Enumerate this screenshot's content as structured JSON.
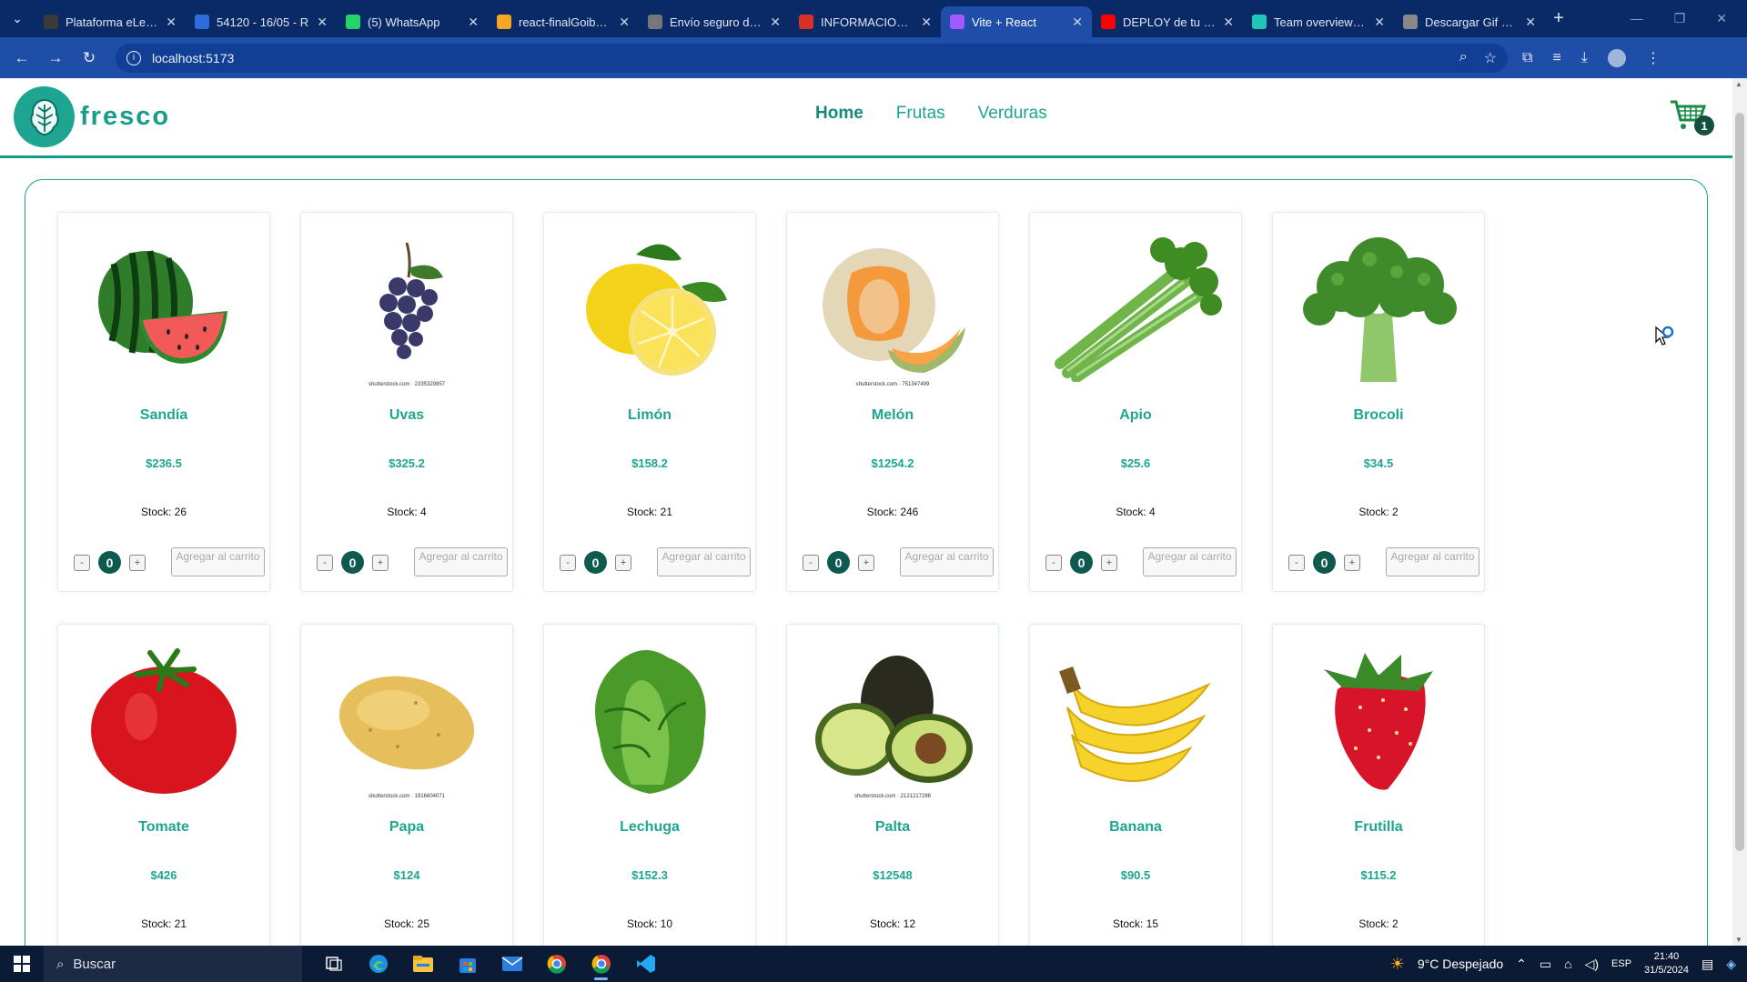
{
  "browser": {
    "tabs": [
      {
        "title": "Plataforma eLearn",
        "icon": "elearning-icon",
        "color": "#3a3a3a",
        "active": false
      },
      {
        "title": "54120 - 16/05 - R",
        "icon": "zoom-icon",
        "color": "#2d6cdf",
        "active": false
      },
      {
        "title": "(5) WhatsApp",
        "icon": "whatsapp-icon",
        "color": "#25d366",
        "active": false
      },
      {
        "title": "react-finalGoiburu",
        "icon": "firebase-icon",
        "color": "#f5a623",
        "active": false
      },
      {
        "title": "Envío seguro de c",
        "icon": "shield-icon",
        "color": "#777777",
        "active": false
      },
      {
        "title": "INFORMACION M",
        "icon": "gmail-icon",
        "color": "#d93025",
        "active": false
      },
      {
        "title": "Vite + React",
        "icon": "vite-icon",
        "color": "#a259ff",
        "active": true
      },
      {
        "title": "DEPLOY de tu app",
        "icon": "youtube-icon",
        "color": "#ff0000",
        "active": false
      },
      {
        "title": "Team overview | s",
        "icon": "netlify-icon",
        "color": "#20c6b7",
        "active": false
      },
      {
        "title": "Descargar Gif Rec",
        "icon": "gif-icon",
        "color": "#888888",
        "active": false
      }
    ],
    "url": "localhost:5173"
  },
  "header": {
    "logo_text": "fresco",
    "nav": [
      {
        "label": "Home",
        "active": true
      },
      {
        "label": "Frutas",
        "active": false
      },
      {
        "label": "Verduras",
        "active": false
      }
    ],
    "cart_count": "1"
  },
  "products": [
    {
      "name": "Sandía",
      "price": "$236.5",
      "stock": "Stock: 26",
      "qty": "0",
      "icon": "watermelon-image",
      "credit": ""
    },
    {
      "name": "Uvas",
      "price": "$325.2",
      "stock": "Stock: 4",
      "qty": "0",
      "icon": "grapes-image",
      "credit": "shutterstock.com · 2335329857"
    },
    {
      "name": "Limón",
      "price": "$158.2",
      "stock": "Stock: 21",
      "qty": "0",
      "icon": "lemon-image",
      "credit": ""
    },
    {
      "name": "Melón",
      "price": "$1254.2",
      "stock": "Stock: 246",
      "qty": "0",
      "icon": "melon-image",
      "credit": "shutterstock.com · 751347499"
    },
    {
      "name": "Apio",
      "price": "$25.6",
      "stock": "Stock: 4",
      "qty": "0",
      "icon": "celery-image",
      "credit": ""
    },
    {
      "name": "Brocoli",
      "price": "$34.5",
      "stock": "Stock: 2",
      "qty": "0",
      "icon": "broccoli-image",
      "credit": ""
    },
    {
      "name": "Tomate",
      "price": "$426",
      "stock": "Stock: 21",
      "qty": "0",
      "icon": "tomato-image",
      "credit": ""
    },
    {
      "name": "Papa",
      "price": "$124",
      "stock": "Stock: 25",
      "qty": "0",
      "icon": "potato-image",
      "credit": "shutterstock.com · 1916604071"
    },
    {
      "name": "Lechuga",
      "price": "$152.3",
      "stock": "Stock: 10",
      "qty": "0",
      "icon": "lettuce-image",
      "credit": ""
    },
    {
      "name": "Palta",
      "price": "$12548",
      "stock": "Stock: 12",
      "qty": "0",
      "icon": "avocado-image",
      "credit": "shutterstock.com · 2121217286"
    },
    {
      "name": "Banana",
      "price": "$90.5",
      "stock": "Stock: 15",
      "qty": "0",
      "icon": "banana-image",
      "credit": ""
    },
    {
      "name": "Frutilla",
      "price": "$115.2",
      "stock": "Stock: 2",
      "qty": "0",
      "icon": "strawberry-image",
      "credit": ""
    }
  ],
  "add_to_cart_label": "Agregar al carrito",
  "minus_label": "-",
  "plus_label": "+",
  "taskbar": {
    "search_placeholder": "Buscar",
    "weather": "9°C  Despejado",
    "lang": "ESP",
    "time": "21:40",
    "date": "31/5/2024"
  }
}
